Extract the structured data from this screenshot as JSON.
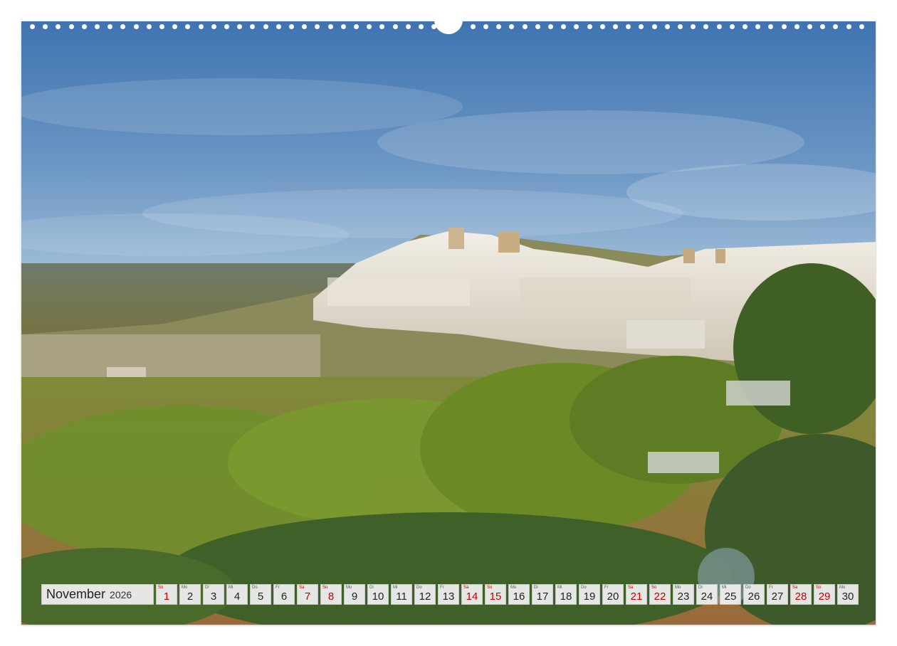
{
  "calendar": {
    "month": "November",
    "year": "2026",
    "days": [
      {
        "wd": "So",
        "n": "1",
        "weekend": true
      },
      {
        "wd": "Mo",
        "n": "2",
        "weekend": false
      },
      {
        "wd": "Di",
        "n": "3",
        "weekend": false
      },
      {
        "wd": "Mi",
        "n": "4",
        "weekend": false
      },
      {
        "wd": "Do",
        "n": "5",
        "weekend": false
      },
      {
        "wd": "Fr",
        "n": "6",
        "weekend": false
      },
      {
        "wd": "Sa",
        "n": "7",
        "weekend": true
      },
      {
        "wd": "So",
        "n": "8",
        "weekend": true
      },
      {
        "wd": "Mo",
        "n": "9",
        "weekend": false
      },
      {
        "wd": "Di",
        "n": "10",
        "weekend": false
      },
      {
        "wd": "Mi",
        "n": "11",
        "weekend": false
      },
      {
        "wd": "Do",
        "n": "12",
        "weekend": false
      },
      {
        "wd": "Fr",
        "n": "13",
        "weekend": false
      },
      {
        "wd": "Sa",
        "n": "14",
        "weekend": true
      },
      {
        "wd": "So",
        "n": "15",
        "weekend": true
      },
      {
        "wd": "Mo",
        "n": "16",
        "weekend": false
      },
      {
        "wd": "Di",
        "n": "17",
        "weekend": false
      },
      {
        "wd": "Mi",
        "n": "18",
        "weekend": false
      },
      {
        "wd": "Do",
        "n": "19",
        "weekend": false
      },
      {
        "wd": "Fr",
        "n": "20",
        "weekend": false
      },
      {
        "wd": "Sa",
        "n": "21",
        "weekend": true
      },
      {
        "wd": "So",
        "n": "22",
        "weekend": true
      },
      {
        "wd": "Mo",
        "n": "23",
        "weekend": false
      },
      {
        "wd": "Di",
        "n": "24",
        "weekend": false
      },
      {
        "wd": "Mi",
        "n": "25",
        "weekend": false
      },
      {
        "wd": "Do",
        "n": "26",
        "weekend": false
      },
      {
        "wd": "Fr",
        "n": "27",
        "weekend": false
      },
      {
        "wd": "Sa",
        "n": "28",
        "weekend": true
      },
      {
        "wd": "So",
        "n": "29",
        "weekend": true
      },
      {
        "wd": "Mo",
        "n": "30",
        "weekend": false
      }
    ]
  },
  "colors": {
    "weekend": "#c00000",
    "sky_top": "#3f74b0",
    "sky_bottom": "#a9c4dc",
    "town": "#e8e2d6",
    "vegetation": "#6f8f2c"
  },
  "icons": {
    "photo": "landscape-photo",
    "binding": "spiral-binding-holes",
    "hanger": "wall-hanger-notch"
  }
}
